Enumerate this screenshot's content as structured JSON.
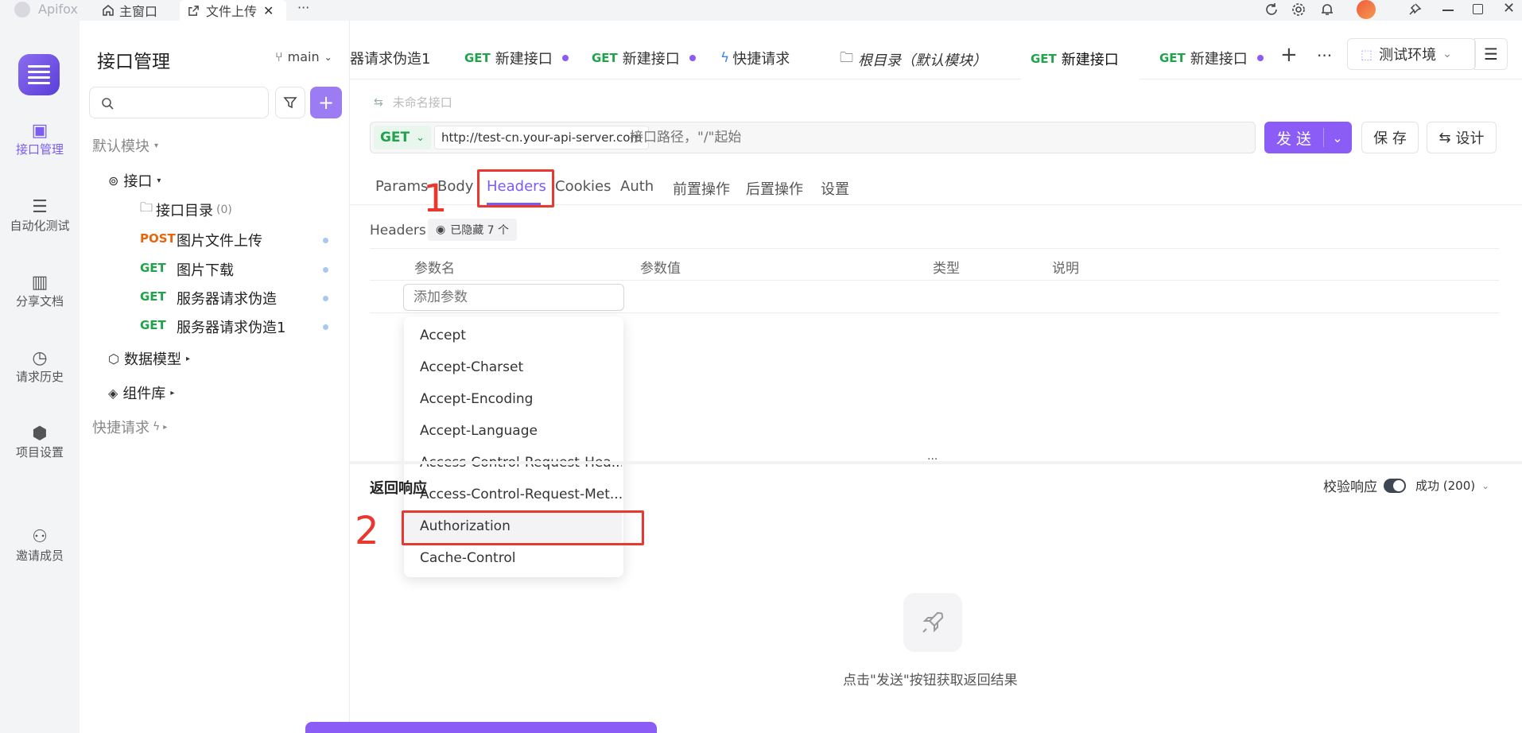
{
  "titlebar": {
    "app_name": "Apifox",
    "tab_home": "主窗口",
    "tab_upload": "文件上传",
    "more": "···"
  },
  "rail": {
    "items": [
      {
        "label": "接口管理",
        "icon": "api-icon"
      },
      {
        "label": "自动化测试",
        "icon": "automation-icon"
      },
      {
        "label": "分享文档",
        "icon": "book-icon"
      },
      {
        "label": "请求历史",
        "icon": "clock-icon"
      },
      {
        "label": "项目设置",
        "icon": "settings-icon"
      },
      {
        "label": "邀请成员",
        "icon": "add-user-icon"
      }
    ]
  },
  "sidebar": {
    "title": "接口管理",
    "branch": "main",
    "default_module": "默认模块",
    "api_folder": "接口",
    "dir_label": "接口目录",
    "dir_count": "(0)",
    "endpoints": [
      {
        "method": "POST",
        "name": "图片文件上传"
      },
      {
        "method": "GET",
        "name": "图片下载"
      },
      {
        "method": "GET",
        "name": "服务器请求伪造"
      },
      {
        "method": "GET",
        "name": "服务器请求伪造1"
      }
    ],
    "data_model": "数据模型",
    "components": "组件库",
    "quick_request": "快捷请求"
  },
  "tabs": [
    {
      "method": "",
      "label": "器请求伪造1"
    },
    {
      "method": "GET",
      "label": "新建接口"
    },
    {
      "method": "GET",
      "label": "新建接口"
    },
    {
      "method": "",
      "label": "快捷请求"
    },
    {
      "method": "",
      "label": "根目录（默认模块）"
    },
    {
      "method": "GET",
      "label": "新建接口"
    },
    {
      "method": "GET",
      "label": "新建接口"
    }
  ],
  "env": "测试环境",
  "request": {
    "name_placeholder": "未命名接口",
    "method": "GET",
    "base_url": "http://test-cn.your-api-server.com",
    "path_placeholder": "接口路径，\"/\"起始",
    "send": "发 送",
    "save": "保 存",
    "design": "设计"
  },
  "subtabs": [
    "Params",
    "Body",
    "Headers",
    "Cookies",
    "Auth",
    "前置操作",
    "后置操作",
    "设置"
  ],
  "headers": {
    "label": "Headers",
    "hidden": "已隐藏 7 个",
    "col_name": "参数名",
    "col_value": "参数值",
    "col_type": "类型",
    "col_desc": "说明",
    "add_placeholder": "添加参数"
  },
  "dropdown": [
    "Accept",
    "Accept-Charset",
    "Accept-Encoding",
    "Accept-Language",
    "Access-Control-Request-Hea...",
    "Access-Control-Request-Met...",
    "Authorization",
    "Cache-Control"
  ],
  "response": {
    "title": "返回响应",
    "validate": "校验响应",
    "status": "成功 (200)",
    "empty_hint": "点击\"发送\"按钮获取返回结果"
  },
  "annotations": {
    "one": "1",
    "two": "2"
  },
  "colors": {
    "accent": "#8b5cf6",
    "get": "#20a34a",
    "post": "#e8650c",
    "annotation": "#e8382f"
  }
}
